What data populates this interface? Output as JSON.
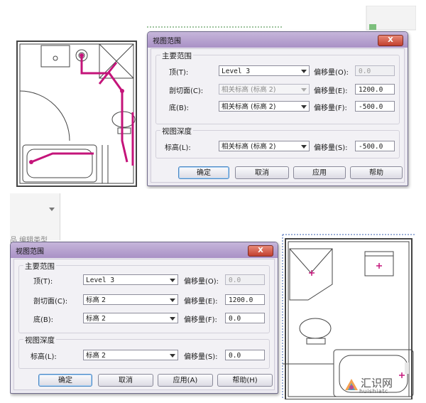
{
  "panel_top": {
    "dialog": {
      "title": "视图范围",
      "close_label": "X",
      "primary_range": {
        "title": "主要范围",
        "top": {
          "label": "顶(T):",
          "value": "Level 3",
          "offset_label": "偏移量(O):",
          "offset_value": "0.0"
        },
        "cut_plane": {
          "label": "剖切面(C):",
          "value": "相关标高 (标高 2)",
          "offset_label": "偏移量(E):",
          "offset_value": "1200.0"
        },
        "bottom": {
          "label": "底(B):",
          "value": "相关标高 (标高 2)",
          "offset_label": "偏移量(F):",
          "offset_value": "-500.0"
        }
      },
      "view_depth": {
        "title": "视图深度",
        "level": {
          "label": "标高(L):",
          "value": "相关标高 (标高 2)",
          "offset_label": "偏移量(S):",
          "offset_value": "-500.0"
        }
      },
      "buttons": {
        "ok": "确定",
        "cancel": "取消",
        "apply": "应用",
        "help": "帮助"
      }
    }
  },
  "panel_bottom": {
    "edit_type_label": "品 编辑类型",
    "dialog": {
      "title": "视图范围",
      "close_label": "X",
      "primary_range": {
        "title": "主要范围",
        "top": {
          "label": "顶(T):",
          "value": "Level 3",
          "offset_label": "偏移量(O):",
          "offset_value": "0.0"
        },
        "cut_plane": {
          "label": "剖切面(C):",
          "value": "标高 2",
          "offset_label": "偏移量(E):",
          "offset_value": "1200.0"
        },
        "bottom": {
          "label": "底(B):",
          "value": "标高 2",
          "offset_label": "偏移量(F):",
          "offset_value": "0.0"
        }
      },
      "view_depth": {
        "title": "视图深度",
        "level": {
          "label": "标高(L):",
          "value": "标高 2",
          "offset_label": "偏移量(S):",
          "offset_value": "0.0"
        }
      },
      "buttons": {
        "ok": "确定",
        "cancel": "取消",
        "apply": "应用(A)",
        "help": "帮助(H)"
      }
    }
  },
  "watermark": {
    "name": "汇识网",
    "url": "huishiatc"
  },
  "colors": {
    "accent_pipe": "#c4147a",
    "title_bar": "#b39ccd",
    "default_button_border": "#4b87c3"
  },
  "icons": [
    "close-icon",
    "dropdown-arrow-icon",
    "site-logo-icon"
  ]
}
